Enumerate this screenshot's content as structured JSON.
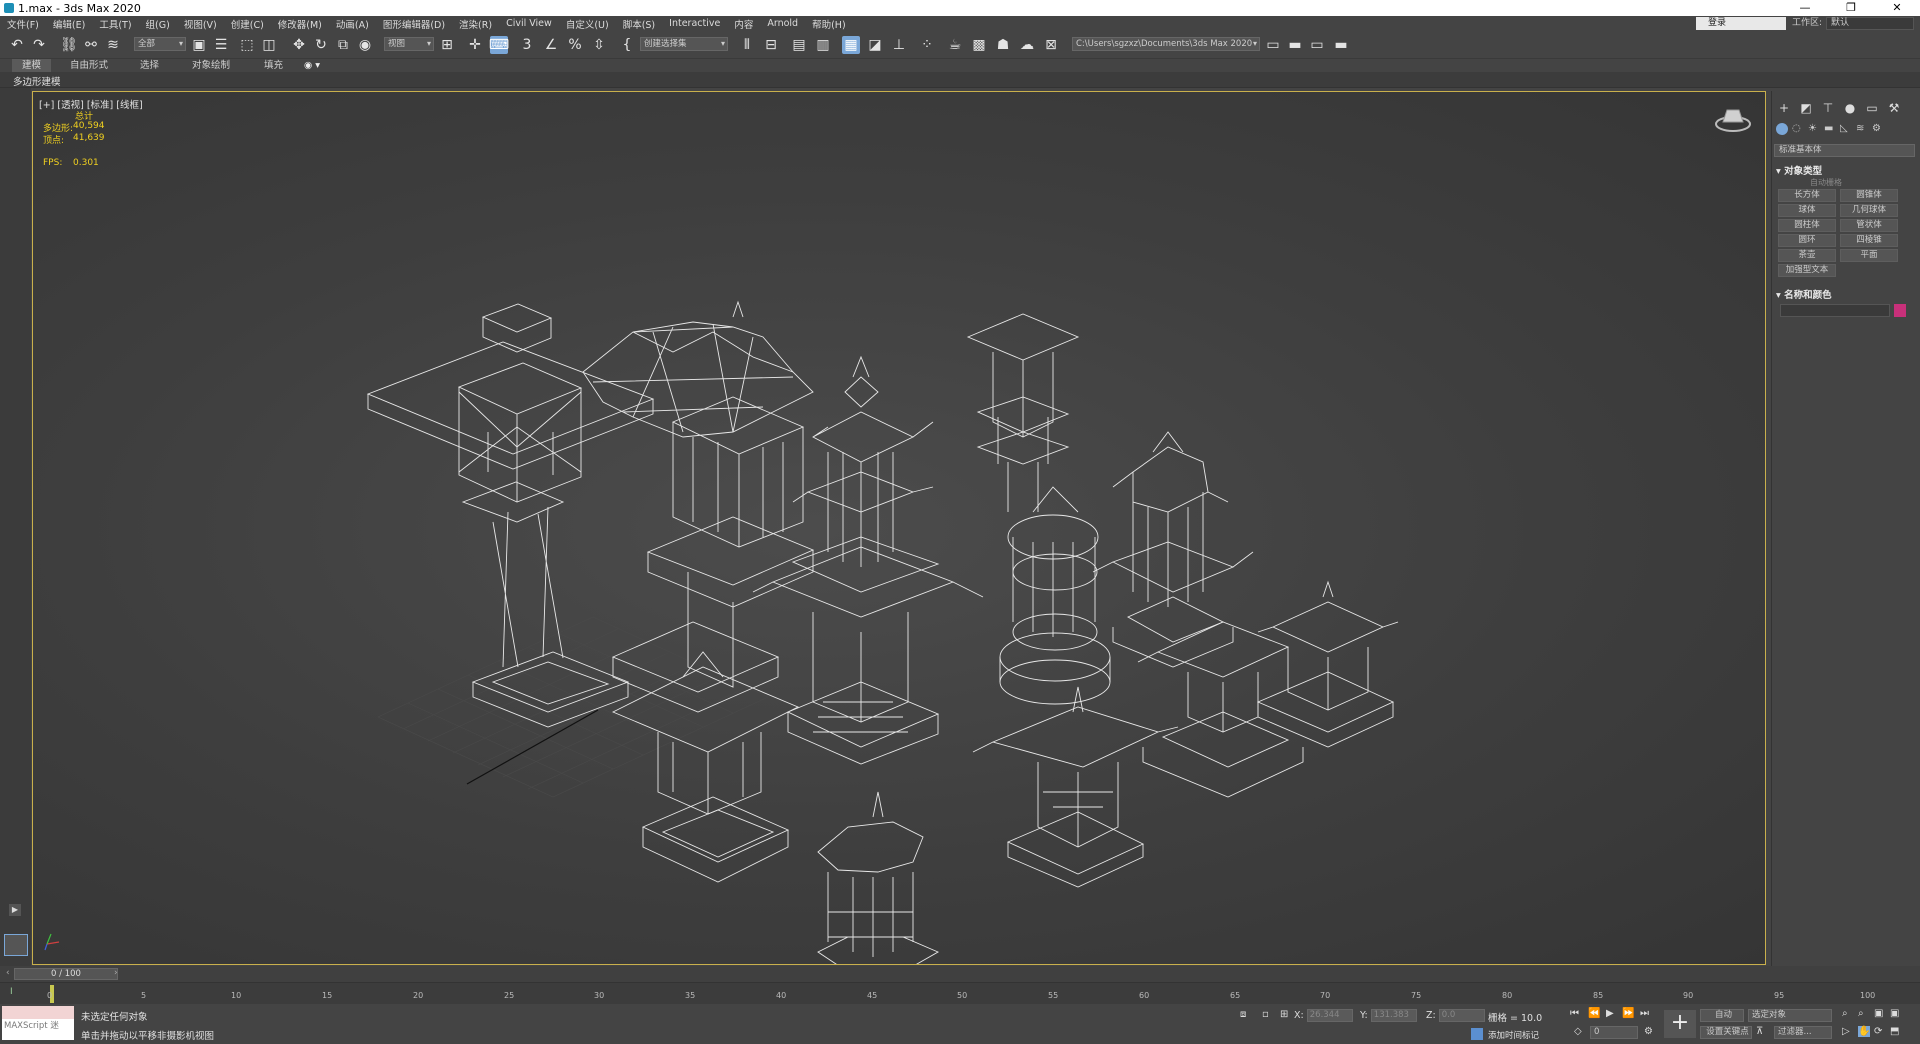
{
  "window": {
    "title": "1.max - 3ds Max 2020",
    "controls": [
      "—",
      "❐",
      "✕"
    ]
  },
  "menu": {
    "items": [
      "文件(F)",
      "编辑(E)",
      "工具(T)",
      "组(G)",
      "视图(V)",
      "创建(C)",
      "修改器(M)",
      "动画(A)",
      "图形编辑器(D)",
      "渲染(R)",
      "Civil View",
      "自定义(U)",
      "脚本(S)",
      "Interactive",
      "内容",
      "Arnold",
      "帮助(H)"
    ],
    "login": "登录",
    "workspace_label": "工作区:",
    "workspace_value": "默认"
  },
  "toolbar": {
    "filter_dropdown": "全部",
    "ref_coord_dropdown": "视图",
    "selection_set_dropdown": "创建选择集",
    "project_path": "C:\\Users\\sgzxz\\Documents\\3ds Max 2020"
  },
  "ribbon": {
    "tabs": [
      "建模",
      "自由形式",
      "选择",
      "对象绘制",
      "填充"
    ],
    "active_tab": "建模",
    "sub_label": "多边形建模"
  },
  "viewport": {
    "label": "[+] [透视] [标准] [线框]",
    "stats_header": "总计",
    "polys_label": "多边形:",
    "polys_value": "40,594",
    "verts_label": "顶点:",
    "verts_value": "41,639",
    "fps_label": "FPS:",
    "fps_value": "0.301"
  },
  "command_panel": {
    "dropdown": "标准基本体",
    "object_type_title": "对象类型",
    "autogrid": "自动栅格",
    "buttons": [
      "长方体",
      "圆锥体",
      "球体",
      "几何球体",
      "圆柱体",
      "管状体",
      "圆环",
      "四棱锥",
      "茶壶",
      "平面",
      "加强型文本"
    ],
    "name_color_title": "名称和颜色",
    "object_color": "#c8307a"
  },
  "timeline": {
    "frame_display": "0 / 100",
    "ticks": [
      "0",
      "5",
      "10",
      "15",
      "20",
      "25",
      "30",
      "35",
      "40",
      "45",
      "50",
      "55",
      "60",
      "65",
      "70",
      "75",
      "80",
      "85",
      "90",
      "95",
      "100"
    ]
  },
  "status": {
    "maxscript_label": "MAXScript 迷",
    "line1": "未选定任何对象",
    "line2": "单击并拖动以平移非摄影机视图",
    "x_label": "X:",
    "x_value": "26.344",
    "y_label": "Y:",
    "y_value": "131.383",
    "z_label": "Z:",
    "z_value": "0.0",
    "grid_text": "栅格 = 10.0",
    "add_time_tag": "添加时间标记",
    "auto_button": "自动",
    "selected_objects": "选定对象",
    "set_key": "设置关键点",
    "filter_button": "过滤器...",
    "frame_field": "0"
  },
  "accent_colors": {
    "viewport_border": "#c9b04c",
    "stat_text": "#f0d020",
    "active_tool": "#7aa7d8"
  }
}
